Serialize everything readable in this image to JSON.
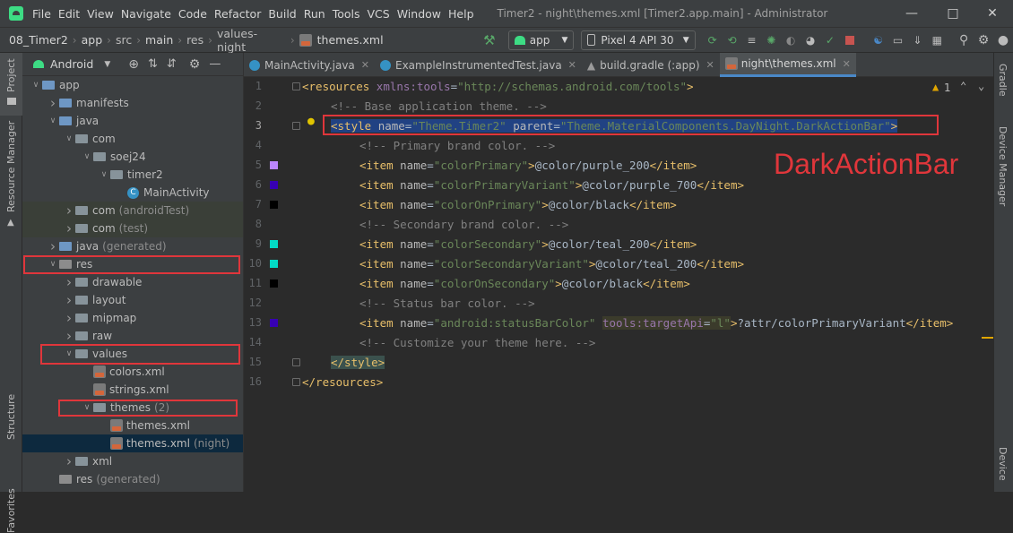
{
  "menu": [
    "File",
    "Edit",
    "View",
    "Navigate",
    "Code",
    "Refactor",
    "Build",
    "Run",
    "Tools",
    "VCS",
    "Window",
    "Help"
  ],
  "window_title": "Timer2 - night\\themes.xml [Timer2.app.main] - Administrator",
  "breadcrumb": [
    "08_Timer2",
    "app",
    "src",
    "main",
    "res",
    "values-night",
    "themes.xml"
  ],
  "run_config": "app",
  "device": "Pixel 4 API 30",
  "project_view": "Android",
  "left_strip": [
    "Project",
    "Resource Manager",
    "Structure",
    "Favorites"
  ],
  "right_strip": [
    "Gradle",
    "Device Manager",
    "Device"
  ],
  "tabs": [
    {
      "label": "MainActivity.java",
      "active": false
    },
    {
      "label": "ExampleInstrumentedTest.java",
      "active": false
    },
    {
      "label": "build.gradle (:app)",
      "active": false
    },
    {
      "label": "night\\themes.xml",
      "active": true
    }
  ],
  "tree": [
    {
      "label": "app",
      "hint": "",
      "icon": "folder-blue",
      "arrow": "open"
    },
    {
      "label": "manifests",
      "hint": "",
      "icon": "folder-blue",
      "arrow": "closed"
    },
    {
      "label": "java",
      "hint": "",
      "icon": "folder-blue",
      "arrow": "open"
    },
    {
      "label": "com",
      "hint": "",
      "icon": "folder",
      "arrow": "open"
    },
    {
      "label": "soej24",
      "hint": "",
      "icon": "folder",
      "arrow": "open"
    },
    {
      "label": "timer2",
      "hint": "",
      "icon": "folder",
      "arrow": "open"
    },
    {
      "label": "MainActivity",
      "hint": "",
      "icon": "class",
      "arrow": ""
    },
    {
      "label": "com",
      "hint": "(androidTest)",
      "icon": "folder",
      "arrow": "closed"
    },
    {
      "label": "com",
      "hint": "(test)",
      "icon": "folder",
      "arrow": "closed"
    },
    {
      "label": "java",
      "hint": "(generated)",
      "icon": "folder-blue",
      "arrow": "closed"
    },
    {
      "label": "res",
      "hint": "",
      "icon": "folder-res",
      "arrow": "open"
    },
    {
      "label": "drawable",
      "hint": "",
      "icon": "folder",
      "arrow": "closed"
    },
    {
      "label": "layout",
      "hint": "",
      "icon": "folder",
      "arrow": "closed"
    },
    {
      "label": "mipmap",
      "hint": "",
      "icon": "folder",
      "arrow": "closed"
    },
    {
      "label": "raw",
      "hint": "",
      "icon": "folder",
      "arrow": "closed"
    },
    {
      "label": "values",
      "hint": "",
      "icon": "folder",
      "arrow": "open"
    },
    {
      "label": "colors.xml",
      "hint": "",
      "icon": "xml",
      "arrow": ""
    },
    {
      "label": "strings.xml",
      "hint": "",
      "icon": "xml",
      "arrow": ""
    },
    {
      "label": "themes",
      "hint": "(2)",
      "icon": "folder",
      "arrow": "open"
    },
    {
      "label": "themes.xml",
      "hint": "",
      "icon": "xml",
      "arrow": ""
    },
    {
      "label": "themes.xml",
      "hint": "(night)",
      "icon": "xml",
      "arrow": ""
    },
    {
      "label": "xml",
      "hint": "",
      "icon": "folder",
      "arrow": "closed"
    },
    {
      "label": "res",
      "hint": "(generated)",
      "icon": "folder-res",
      "arrow": ""
    }
  ],
  "inspection": "1",
  "annotation": "DarkActionBar",
  "code": {
    "l1": {
      "open": "<resources ",
      "ns": "xmlns:tools",
      "eq": "=",
      "val": "\"http://schemas.android.com/tools\"",
      "close": ">"
    },
    "l2": "<!-- Base application theme. -->",
    "l3": {
      "open": "<style ",
      "a1": "name",
      "v1": "\"Theme.Timer2\"",
      "a2": "parent",
      "v2": "\"Theme.MaterialComponents.DayNight.DarkActionBar\"",
      "close": ">"
    },
    "l4": "<!-- Primary brand color. -->",
    "l5": {
      "name": "\"colorPrimary\"",
      "value": "@color/purple_200"
    },
    "l6": {
      "name": "\"colorPrimaryVariant\"",
      "value": "@color/purple_700"
    },
    "l7": {
      "name": "\"colorOnPrimary\"",
      "value": "@color/black"
    },
    "l8": "<!-- Secondary brand color. -->",
    "l9": {
      "name": "\"colorSecondary\"",
      "value": "@color/teal_200"
    },
    "l10": {
      "name": "\"colorSecondaryVariant\"",
      "value": "@color/teal_200"
    },
    "l11": {
      "name": "\"colorOnSecondary\"",
      "value": "@color/black"
    },
    "l12": "<!-- Status bar color. -->",
    "l13": {
      "name": "\"android:statusBarColor\"",
      "tgt": "tools:targetApi",
      "tgtv": "\"l\"",
      "value": "?attr/colorPrimaryVariant"
    },
    "l14": "<!-- Customize your theme here. -->",
    "l15": "</style>",
    "l16": "</resources>",
    "item_open": "<item ",
    "item_name": "name",
    "eq": "=",
    "gt": ">",
    "item_close": "</item>"
  },
  "swatches": {
    "purple_200": "#bb86fc",
    "purple_700": "#3700b3",
    "black": "#000000",
    "teal_200": "#03dac5"
  }
}
